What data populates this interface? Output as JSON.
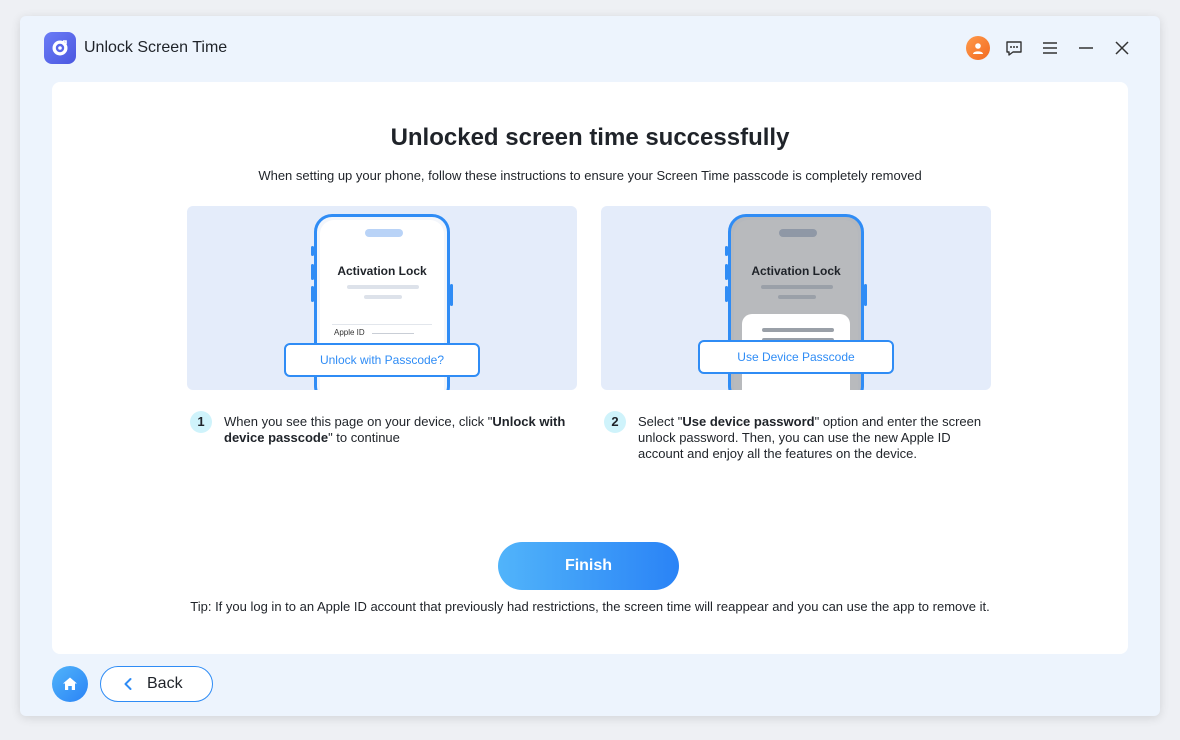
{
  "app": {
    "title": "Unlock Screen Time"
  },
  "titlebar_icons": [
    "user-avatar-icon",
    "feedback-icon",
    "menu-icon",
    "minimize-icon",
    "close-icon"
  ],
  "main": {
    "headline": "Unlocked screen time successfully",
    "subline": "When setting up your phone, follow these instructions to ensure your Screen Time passcode is completely removed",
    "illustrations": [
      {
        "phone_title": "Activation Lock",
        "field_label": "Apple ID",
        "callout": "Unlock with Passcode?"
      },
      {
        "phone_title": "Activation Lock",
        "callout": "Use Device Passcode"
      }
    ],
    "steps": [
      {
        "number": "1",
        "pre": "When you see this page on your device, click \"",
        "bold": "Unlock with device passcode",
        "post": "\" to continue"
      },
      {
        "number": "2",
        "pre": "Select \"",
        "bold": "Use device password",
        "post": "\" option and enter the screen unlock password. Then, you can use the new Apple ID account and enjoy all the features on the device."
      }
    ],
    "finish_label": "Finish",
    "tip": "Tip: If you log in to an Apple ID account that previously had restrictions, the screen time will reappear and you can use the app to remove it."
  },
  "footer": {
    "back_label": "Back"
  },
  "colors": {
    "accent": "#2f8cf5",
    "avatar": "#f26a22",
    "step_badge": "#cff3fb"
  }
}
